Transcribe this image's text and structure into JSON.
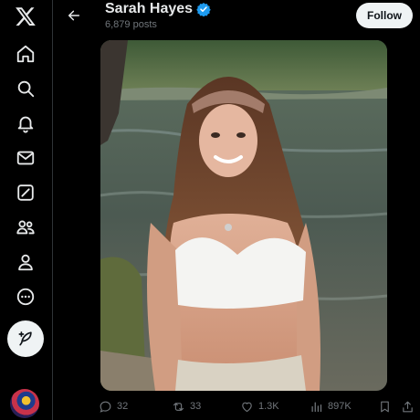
{
  "nav": {
    "logo_icon": "x-logo-icon",
    "items": [
      {
        "name": "home",
        "icon": "home-icon"
      },
      {
        "name": "explore",
        "icon": "search-icon"
      },
      {
        "name": "notifications",
        "icon": "bell-icon"
      },
      {
        "name": "messages",
        "icon": "mail-icon"
      },
      {
        "name": "grok",
        "icon": "grok-icon"
      },
      {
        "name": "communities",
        "icon": "people-icon"
      },
      {
        "name": "profile",
        "icon": "person-icon"
      },
      {
        "name": "more",
        "icon": "more-icon"
      }
    ],
    "post_button_icon": "feather-plus-icon"
  },
  "header": {
    "back_icon": "arrow-left-icon",
    "name": "Sarah Hayes",
    "verified_icon": "verified-badge-icon",
    "post_count": "6,879 posts",
    "follow_label": "Follow"
  },
  "post": {
    "media_description_icon": "photo",
    "stats": {
      "replies": "32",
      "reposts": "33",
      "likes": "1.3K",
      "views": "897K"
    }
  },
  "colors": {
    "background": "#000000",
    "text": "#e7e9ea",
    "muted": "#71767b",
    "verified": "#1d9bf0",
    "follow_bg": "#eff3f4"
  }
}
